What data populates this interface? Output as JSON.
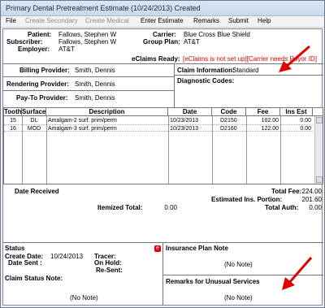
{
  "window": {
    "title": "Primary Dental Pretreatment Estimate (10/24/2013) Created"
  },
  "menu": {
    "file": "File",
    "create_secondary": "Create Secondary",
    "create_medical": "Create Medical",
    "enter_estimate": "Enter Estimate",
    "remarks": "Remarks",
    "submit": "Submit",
    "help": "Help"
  },
  "header": {
    "patient_label": "Patient:",
    "patient": "Fallows, Stephen W",
    "subscriber_label": "Subscriber:",
    "subscriber": "Fallows, Stephen W",
    "employer_label": "Employer:",
    "employer": "AT&T",
    "carrier_label": "Carrier:",
    "carrier": "Blue Cross Blue Shield",
    "group_plan_label": "Group Plan:",
    "group_plan": "AT&T",
    "eclaims_label": "eClaims Ready:",
    "eclaims": "[eClaims is not set up][Carrier needs Payor ID]"
  },
  "providers": {
    "billing_label": "Billing Provider:",
    "billing": "Smith, Dennis",
    "rendering_label": "Rendering Provider:",
    "rendering": "Smith, Dennis",
    "paytoo_label": "Pay-To Provider:",
    "paytoo": "Smith, Dennis"
  },
  "claim": {
    "info_label": "Claim Information:",
    "info": "Standard",
    "diag_label": "Diagnostic Codes:"
  },
  "table": {
    "headers": [
      "Tooth",
      "Surface",
      "Description",
      "Date",
      "Code",
      "Fee",
      "Ins Est"
    ],
    "rows": [
      [
        "15",
        "DL",
        "Amalgam-2 surf. prim/perm",
        "10/23/2013",
        "D2150",
        "102.00",
        "0.00"
      ],
      [
        "16",
        "MOD",
        "Amalgam-3 surf. prim/perm",
        "10/23/2013",
        "D2160",
        "122.00",
        "0.00"
      ]
    ]
  },
  "totals": {
    "date_received_label": "Date Received",
    "total_fee_label": "Total Fee:",
    "total_fee": "224.00",
    "estimated_ins_label": "Estimated Ins. Portion:",
    "estimated_ins": "201.60",
    "itemized_label": "Itemized Total:",
    "itemized": "0.00",
    "total_auth_label": "Total Auth:",
    "total_auth": "0.00"
  },
  "status": {
    "title": "Status",
    "create_date_label": "Create Date:",
    "create_date": "10/24/2013",
    "tracer_label": "Tracer:",
    "date_sent_label": "Date Sent :",
    "on_hold_label": "On Hold:",
    "re_sent_label": "Re-Sent:",
    "claim_note_label": "Claim Status Note:",
    "claim_note": "(No Note)"
  },
  "notes": {
    "ins_plan_title": "Insurance Plan Note",
    "ins_plan": "(No Note)",
    "unusual_title": "Remarks for Unusual Services",
    "unusual": "(No Note)"
  },
  "colors": {
    "accent": "#e00000",
    "title_bg": "#c9d8ec"
  }
}
